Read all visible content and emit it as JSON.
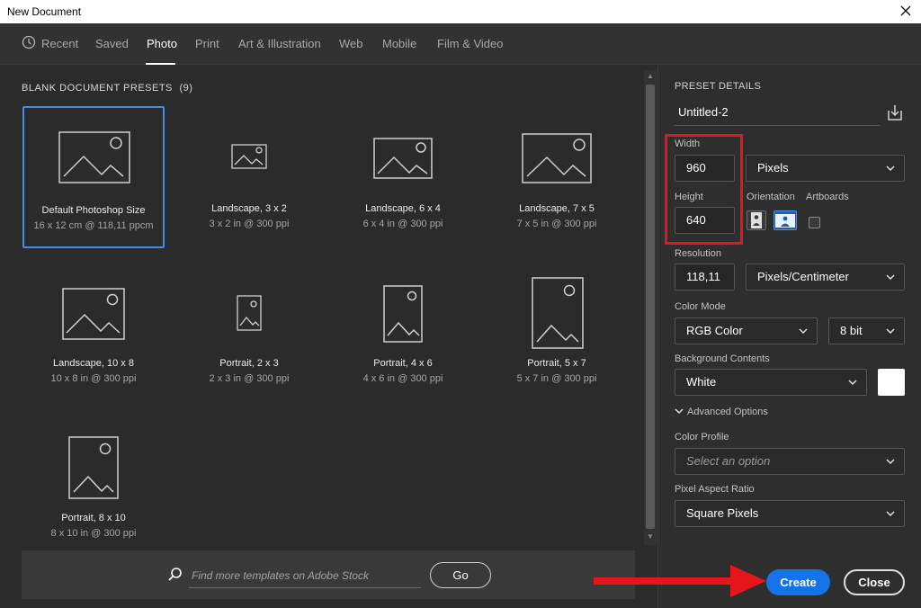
{
  "window": {
    "title": "New Document"
  },
  "tabs": [
    {
      "label": "Recent"
    },
    {
      "label": "Saved"
    },
    {
      "label": "Photo",
      "active": true
    },
    {
      "label": "Print"
    },
    {
      "label": "Art & Illustration"
    },
    {
      "label": "Web"
    },
    {
      "label": "Mobile"
    },
    {
      "label": "Film & Video"
    }
  ],
  "presets_section": {
    "title": "BLANK DOCUMENT PRESETS",
    "count": "(9)"
  },
  "presets": [
    {
      "name": "Default Photoshop Size",
      "desc": "16 x 12 cm @ 118,11 ppcm",
      "selected": true
    },
    {
      "name": "Landscape, 3 x 2",
      "desc": "3 x 2 in @ 300 ppi"
    },
    {
      "name": "Landscape, 6 x 4",
      "desc": "6 x 4 in @ 300 ppi"
    },
    {
      "name": "Landscape, 7 x 5",
      "desc": "7 x 5 in @ 300 ppi"
    },
    {
      "name": "Landscape, 10 x 8",
      "desc": "10 x 8 in @ 300 ppi"
    },
    {
      "name": "Portrait, 2 x 3",
      "desc": "2 x 3 in @ 300 ppi"
    },
    {
      "name": "Portrait, 4 x 6",
      "desc": "4 x 6 in @ 300 ppi"
    },
    {
      "name": "Portrait, 5 x 7",
      "desc": "5 x 7 in @ 300 ppi"
    },
    {
      "name": "Portrait, 8 x 10",
      "desc": "8 x 10 in @ 300 ppi"
    }
  ],
  "search": {
    "placeholder": "Find more templates on Adobe Stock",
    "go_label": "Go"
  },
  "details": {
    "title": "PRESET DETAILS",
    "doc_name": "Untitled-2",
    "width_label": "Width",
    "width_value": "960",
    "width_unit": "Pixels",
    "height_label": "Height",
    "height_value": "640",
    "orientation_label": "Orientation",
    "artboards_label": "Artboards",
    "resolution_label": "Resolution",
    "resolution_value": "118,11",
    "resolution_unit": "Pixels/Centimeter",
    "color_mode_label": "Color Mode",
    "color_mode_value": "RGB Color",
    "bit_depth": "8 bit",
    "bg_label": "Background Contents",
    "bg_value": "White",
    "advanced_label": "Advanced Options",
    "profile_label": "Color Profile",
    "profile_placeholder": "Select an option",
    "aspect_label": "Pixel Aspect Ratio",
    "aspect_value": "Square Pixels"
  },
  "actions": {
    "create_label": "Create",
    "close_label": "Close"
  },
  "colors": {
    "accent": "#1473e6",
    "selection": "#3d8fea",
    "annotation": "#e8141c",
    "background": "#2b2b2b"
  }
}
